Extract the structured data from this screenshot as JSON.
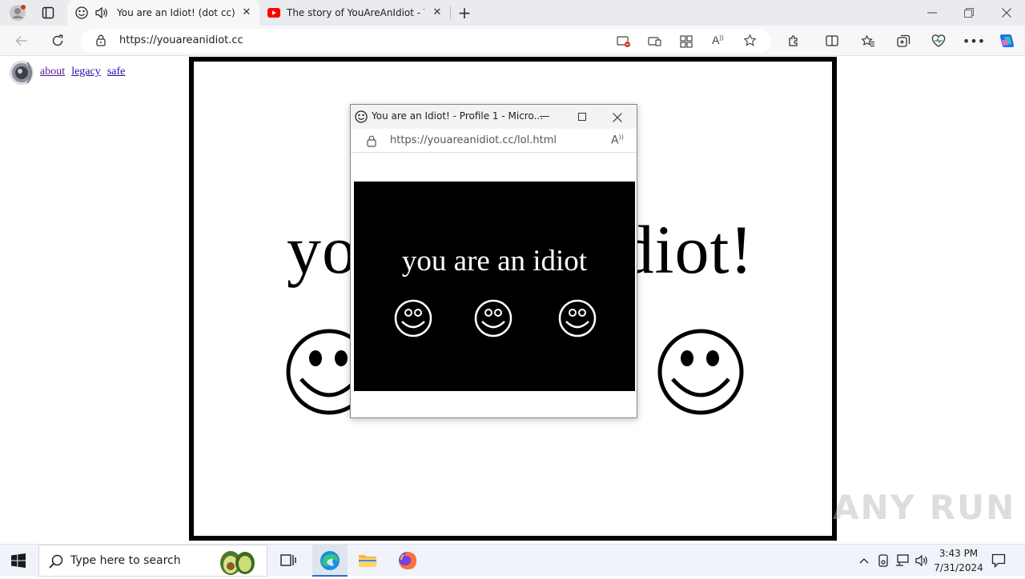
{
  "browser": {
    "tabs": [
      {
        "title": "You are an Idiot! (dot cc)",
        "active": true
      },
      {
        "title": "The story of YouAreAnIdiot - You",
        "active": false
      }
    ],
    "new_tab_label": "+",
    "url": "https://youareanidiot.cc",
    "window_controls": [
      "minimize-icon",
      "restore-icon",
      "close-icon"
    ]
  },
  "page": {
    "top_links": [
      {
        "label": "about",
        "visited": true
      },
      {
        "label": "legacy",
        "visited": false
      },
      {
        "label": "safe",
        "visited": false
      }
    ],
    "headline": "you are an idiot!"
  },
  "popup": {
    "title": "You are an Idiot! - Profile 1 - Micro...",
    "url": "https://youareanidiot.cc/lol.html",
    "text": "you are an idiot"
  },
  "taskbar": {
    "search_placeholder": "Type here to search",
    "time": "3:43 PM",
    "date": "7/31/2024"
  },
  "watermark": "ANY RUN",
  "colors": {
    "link": "#1a0dab",
    "visited_link": "#551a8b",
    "youtube_red": "#ff0000",
    "copilot_blue": "#1f6feb"
  }
}
